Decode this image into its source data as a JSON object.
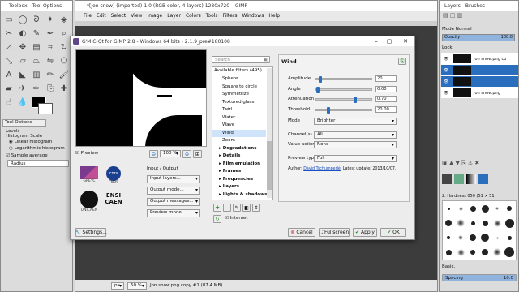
{
  "toolbox": {
    "title": "Toolbox - Tool Options",
    "tool_options": "Tool Options",
    "levels": "Levels",
    "histogram_scale": "Histogram Scale",
    "linear": "Linear histogram",
    "log": "Logarithmic histogram",
    "sample_average": "Sample average",
    "radius": "Radius"
  },
  "gimp": {
    "title": "*[Jon snow] (imported)-1.0 (RGB color, 4 layers) 1280x720 – GIMP",
    "menus": [
      "File",
      "Edit",
      "Select",
      "View",
      "Image",
      "Layer",
      "Colors",
      "Tools",
      "Filters",
      "Windows",
      "Help"
    ],
    "status_unit": "px",
    "status_zoom": "50 %",
    "status_text": "Jon snow.png copy #1 (87.4 MB)"
  },
  "layers": {
    "title": "Layers - Brushes",
    "mode_label": "Mode",
    "mode_value": "Normal",
    "opacity_label": "Opacity",
    "opacity_value": "100.0",
    "lock_label": "Lock:",
    "items": [
      "Jon snow.png co",
      "",
      "",
      "Jon snow.png"
    ],
    "brush_name": "2. Hardness 050 (51 × 51)",
    "basic": "Basic,",
    "spacing_label": "Spacing",
    "spacing_value": "10.0"
  },
  "gmic": {
    "title": "G'MIC-Qt for GIMP 2.8 - Windows 64 bits - 2.1.9_pre#180108",
    "preview_label": "Preview",
    "zoom": "100 %",
    "io_label": "Input / Output",
    "io_selects": [
      "Input layers...",
      "Output mode...",
      "Output messages...",
      "Preview mode..."
    ],
    "settings_btn": "Settings...",
    "search_placeholder": "Search",
    "avail": "Available filters (495)",
    "filters": [
      {
        "name": "Sphere",
        "t": "item"
      },
      {
        "name": "Square to circle",
        "t": "item"
      },
      {
        "name": "Symmetrize",
        "t": "item"
      },
      {
        "name": "Textured glass",
        "t": "item"
      },
      {
        "name": "Twirl",
        "t": "item"
      },
      {
        "name": "Water",
        "t": "item"
      },
      {
        "name": "Wave",
        "t": "item"
      },
      {
        "name": "Wind",
        "t": "sel"
      },
      {
        "name": "Zoom",
        "t": "item"
      },
      {
        "name": "Degradations",
        "t": "cat"
      },
      {
        "name": "Details",
        "t": "cat"
      },
      {
        "name": "Film emulation",
        "t": "cat"
      },
      {
        "name": "Frames",
        "t": "cat"
      },
      {
        "name": "Frequencies",
        "t": "cat"
      },
      {
        "name": "Layers",
        "t": "cat"
      },
      {
        "name": "Lights & shadows",
        "t": "cat"
      }
    ],
    "internet": "Internet",
    "filter_title": "Wind",
    "params": [
      {
        "label": "Amplitude",
        "value": "20",
        "pos": 0.05
      },
      {
        "label": "Angle",
        "value": "0.00",
        "pos": 0.0
      },
      {
        "label": "Attenuation",
        "value": "0.70",
        "pos": 0.7
      },
      {
        "label": "Threshold",
        "value": "20.00",
        "pos": 0.2
      }
    ],
    "mode_label": "Mode",
    "mode_value": "Brighter",
    "channels_label": "Channel(s)",
    "channels_value": "All",
    "value_action_label": "Value action",
    "value_action_value": "None",
    "preview_type_label": "Preview type",
    "preview_type_value": "Full",
    "author_prefix": "Author:",
    "author_name": "David Tschumperlé",
    "latest": ". Latest update: 2013/10/07.",
    "cancel": "Cancel",
    "fullscreen": "Fullscreen",
    "apply": "Apply",
    "ok": "OK",
    "logos": {
      "greyc": "GREYC",
      "cnrs": "CNRS",
      "unicaen": "UNICAEN",
      "ensi": "ENSI",
      "caen": "CAEN"
    }
  }
}
